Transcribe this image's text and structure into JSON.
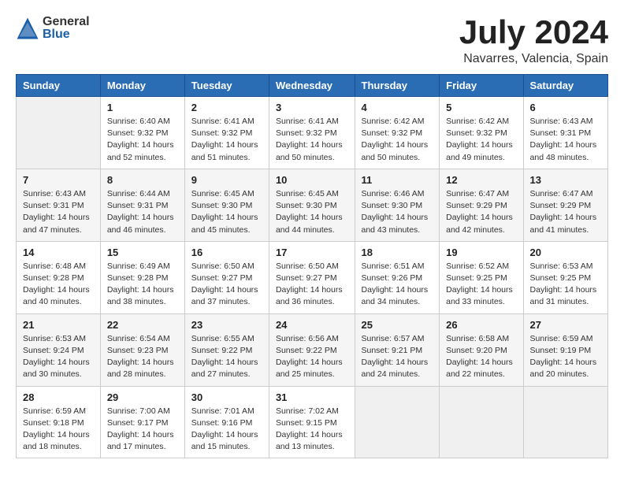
{
  "header": {
    "logo_general": "General",
    "logo_blue": "Blue",
    "month_year": "July 2024",
    "location": "Navarres, Valencia, Spain"
  },
  "days_of_week": [
    "Sunday",
    "Monday",
    "Tuesday",
    "Wednesday",
    "Thursday",
    "Friday",
    "Saturday"
  ],
  "weeks": [
    [
      {
        "day": "",
        "sunrise": "",
        "sunset": "",
        "daylight": ""
      },
      {
        "day": "1",
        "sunrise": "Sunrise: 6:40 AM",
        "sunset": "Sunset: 9:32 PM",
        "daylight": "Daylight: 14 hours and 52 minutes."
      },
      {
        "day": "2",
        "sunrise": "Sunrise: 6:41 AM",
        "sunset": "Sunset: 9:32 PM",
        "daylight": "Daylight: 14 hours and 51 minutes."
      },
      {
        "day": "3",
        "sunrise": "Sunrise: 6:41 AM",
        "sunset": "Sunset: 9:32 PM",
        "daylight": "Daylight: 14 hours and 50 minutes."
      },
      {
        "day": "4",
        "sunrise": "Sunrise: 6:42 AM",
        "sunset": "Sunset: 9:32 PM",
        "daylight": "Daylight: 14 hours and 50 minutes."
      },
      {
        "day": "5",
        "sunrise": "Sunrise: 6:42 AM",
        "sunset": "Sunset: 9:32 PM",
        "daylight": "Daylight: 14 hours and 49 minutes."
      },
      {
        "day": "6",
        "sunrise": "Sunrise: 6:43 AM",
        "sunset": "Sunset: 9:31 PM",
        "daylight": "Daylight: 14 hours and 48 minutes."
      }
    ],
    [
      {
        "day": "7",
        "sunrise": "Sunrise: 6:43 AM",
        "sunset": "Sunset: 9:31 PM",
        "daylight": "Daylight: 14 hours and 47 minutes."
      },
      {
        "day": "8",
        "sunrise": "Sunrise: 6:44 AM",
        "sunset": "Sunset: 9:31 PM",
        "daylight": "Daylight: 14 hours and 46 minutes."
      },
      {
        "day": "9",
        "sunrise": "Sunrise: 6:45 AM",
        "sunset": "Sunset: 9:30 PM",
        "daylight": "Daylight: 14 hours and 45 minutes."
      },
      {
        "day": "10",
        "sunrise": "Sunrise: 6:45 AM",
        "sunset": "Sunset: 9:30 PM",
        "daylight": "Daylight: 14 hours and 44 minutes."
      },
      {
        "day": "11",
        "sunrise": "Sunrise: 6:46 AM",
        "sunset": "Sunset: 9:30 PM",
        "daylight": "Daylight: 14 hours and 43 minutes."
      },
      {
        "day": "12",
        "sunrise": "Sunrise: 6:47 AM",
        "sunset": "Sunset: 9:29 PM",
        "daylight": "Daylight: 14 hours and 42 minutes."
      },
      {
        "day": "13",
        "sunrise": "Sunrise: 6:47 AM",
        "sunset": "Sunset: 9:29 PM",
        "daylight": "Daylight: 14 hours and 41 minutes."
      }
    ],
    [
      {
        "day": "14",
        "sunrise": "Sunrise: 6:48 AM",
        "sunset": "Sunset: 9:28 PM",
        "daylight": "Daylight: 14 hours and 40 minutes."
      },
      {
        "day": "15",
        "sunrise": "Sunrise: 6:49 AM",
        "sunset": "Sunset: 9:28 PM",
        "daylight": "Daylight: 14 hours and 38 minutes."
      },
      {
        "day": "16",
        "sunrise": "Sunrise: 6:50 AM",
        "sunset": "Sunset: 9:27 PM",
        "daylight": "Daylight: 14 hours and 37 minutes."
      },
      {
        "day": "17",
        "sunrise": "Sunrise: 6:50 AM",
        "sunset": "Sunset: 9:27 PM",
        "daylight": "Daylight: 14 hours and 36 minutes."
      },
      {
        "day": "18",
        "sunrise": "Sunrise: 6:51 AM",
        "sunset": "Sunset: 9:26 PM",
        "daylight": "Daylight: 14 hours and 34 minutes."
      },
      {
        "day": "19",
        "sunrise": "Sunrise: 6:52 AM",
        "sunset": "Sunset: 9:25 PM",
        "daylight": "Daylight: 14 hours and 33 minutes."
      },
      {
        "day": "20",
        "sunrise": "Sunrise: 6:53 AM",
        "sunset": "Sunset: 9:25 PM",
        "daylight": "Daylight: 14 hours and 31 minutes."
      }
    ],
    [
      {
        "day": "21",
        "sunrise": "Sunrise: 6:53 AM",
        "sunset": "Sunset: 9:24 PM",
        "daylight": "Daylight: 14 hours and 30 minutes."
      },
      {
        "day": "22",
        "sunrise": "Sunrise: 6:54 AM",
        "sunset": "Sunset: 9:23 PM",
        "daylight": "Daylight: 14 hours and 28 minutes."
      },
      {
        "day": "23",
        "sunrise": "Sunrise: 6:55 AM",
        "sunset": "Sunset: 9:22 PM",
        "daylight": "Daylight: 14 hours and 27 minutes."
      },
      {
        "day": "24",
        "sunrise": "Sunrise: 6:56 AM",
        "sunset": "Sunset: 9:22 PM",
        "daylight": "Daylight: 14 hours and 25 minutes."
      },
      {
        "day": "25",
        "sunrise": "Sunrise: 6:57 AM",
        "sunset": "Sunset: 9:21 PM",
        "daylight": "Daylight: 14 hours and 24 minutes."
      },
      {
        "day": "26",
        "sunrise": "Sunrise: 6:58 AM",
        "sunset": "Sunset: 9:20 PM",
        "daylight": "Daylight: 14 hours and 22 minutes."
      },
      {
        "day": "27",
        "sunrise": "Sunrise: 6:59 AM",
        "sunset": "Sunset: 9:19 PM",
        "daylight": "Daylight: 14 hours and 20 minutes."
      }
    ],
    [
      {
        "day": "28",
        "sunrise": "Sunrise: 6:59 AM",
        "sunset": "Sunset: 9:18 PM",
        "daylight": "Daylight: 14 hours and 18 minutes."
      },
      {
        "day": "29",
        "sunrise": "Sunrise: 7:00 AM",
        "sunset": "Sunset: 9:17 PM",
        "daylight": "Daylight: 14 hours and 17 minutes."
      },
      {
        "day": "30",
        "sunrise": "Sunrise: 7:01 AM",
        "sunset": "Sunset: 9:16 PM",
        "daylight": "Daylight: 14 hours and 15 minutes."
      },
      {
        "day": "31",
        "sunrise": "Sunrise: 7:02 AM",
        "sunset": "Sunset: 9:15 PM",
        "daylight": "Daylight: 14 hours and 13 minutes."
      },
      {
        "day": "",
        "sunrise": "",
        "sunset": "",
        "daylight": ""
      },
      {
        "day": "",
        "sunrise": "",
        "sunset": "",
        "daylight": ""
      },
      {
        "day": "",
        "sunrise": "",
        "sunset": "",
        "daylight": ""
      }
    ]
  ]
}
